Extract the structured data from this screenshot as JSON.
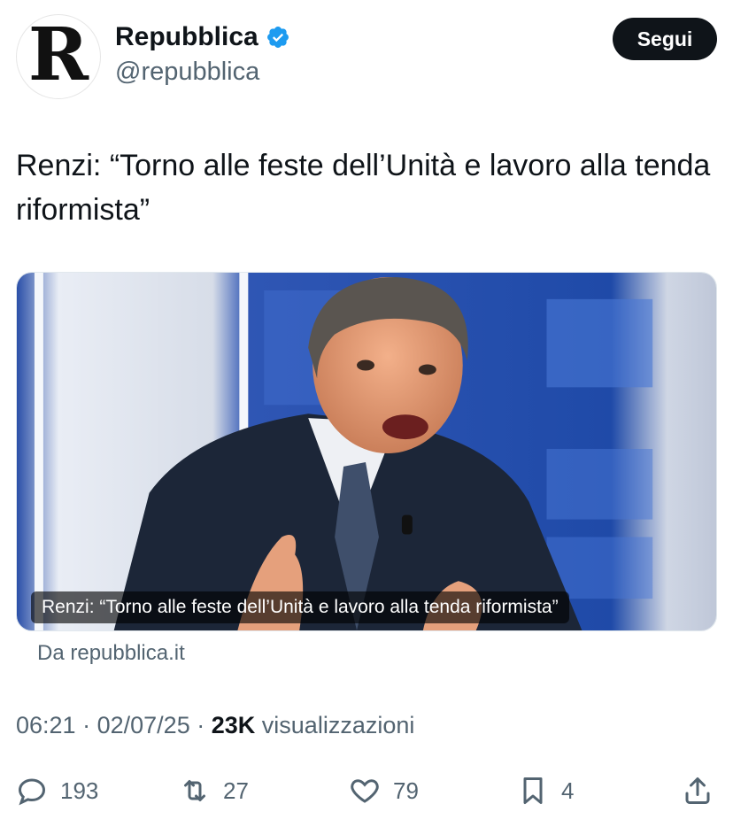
{
  "account": {
    "display_name": "Repubblica",
    "handle": "@repubblica",
    "avatar_letter": "R",
    "verified": true
  },
  "follow_button": {
    "label": "Segui"
  },
  "tweet": {
    "text": "Renzi: “Torno alle feste dell’Unità e lavoro alla tenda riformista”"
  },
  "card": {
    "caption": "Renzi: “Torno alle feste dell’Unità e lavoro alla tenda riformista”",
    "source": "Da repubblica.it"
  },
  "meta": {
    "time": "06:21",
    "sep1": "·",
    "date": "02/07/25",
    "sep2": "·",
    "views_count": "23K",
    "views_label": "visualizzazioni"
  },
  "actions": {
    "replies": "193",
    "reposts": "27",
    "likes": "79",
    "bookmarks": "4"
  },
  "colors": {
    "text_primary": "#0f1419",
    "text_secondary": "#536471",
    "verified": "#1d9bf0",
    "button_bg": "#0f1419"
  },
  "icons": [
    "verified-icon",
    "reply-icon",
    "repost-icon",
    "like-icon",
    "bookmark-icon",
    "share-icon"
  ]
}
